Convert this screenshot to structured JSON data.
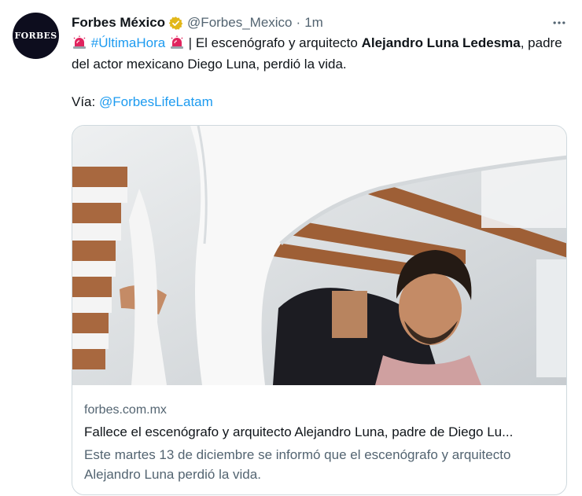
{
  "tweet": {
    "avatar_logo": "FORBES",
    "author": {
      "name": "Forbes México",
      "handle": "@Forbes_Mexico",
      "separator": "·",
      "time": "1m"
    },
    "text": {
      "hashtag": "#ÚltimaHora",
      "part1": " | El escenógrafo y arquitecto ",
      "bold_name": "Alejandro Luna Ledesma",
      "part2": ", padre del actor mexicano Diego Luna, perdió la vida.",
      "via_label": "Vía: ",
      "via_mention": "@ForbesLifeLatam"
    },
    "icons": [
      "siren-emoji",
      "verified-badge-icon",
      "more-options-icon"
    ],
    "colors": {
      "link": "#1d9bf0",
      "muted": "#536471",
      "verified_gold": "#e2b719",
      "siren_red": "#e0245e"
    },
    "card": {
      "domain": "forbes.com.mx",
      "title": "Fallece el escenógrafo y arquitecto Alejandro Luna, padre de Diego Lu...",
      "description": "Este martes 13 de diciembre se informó que el escenógrafo y arquitecto Alejandro Luna perdió la vida."
    }
  }
}
